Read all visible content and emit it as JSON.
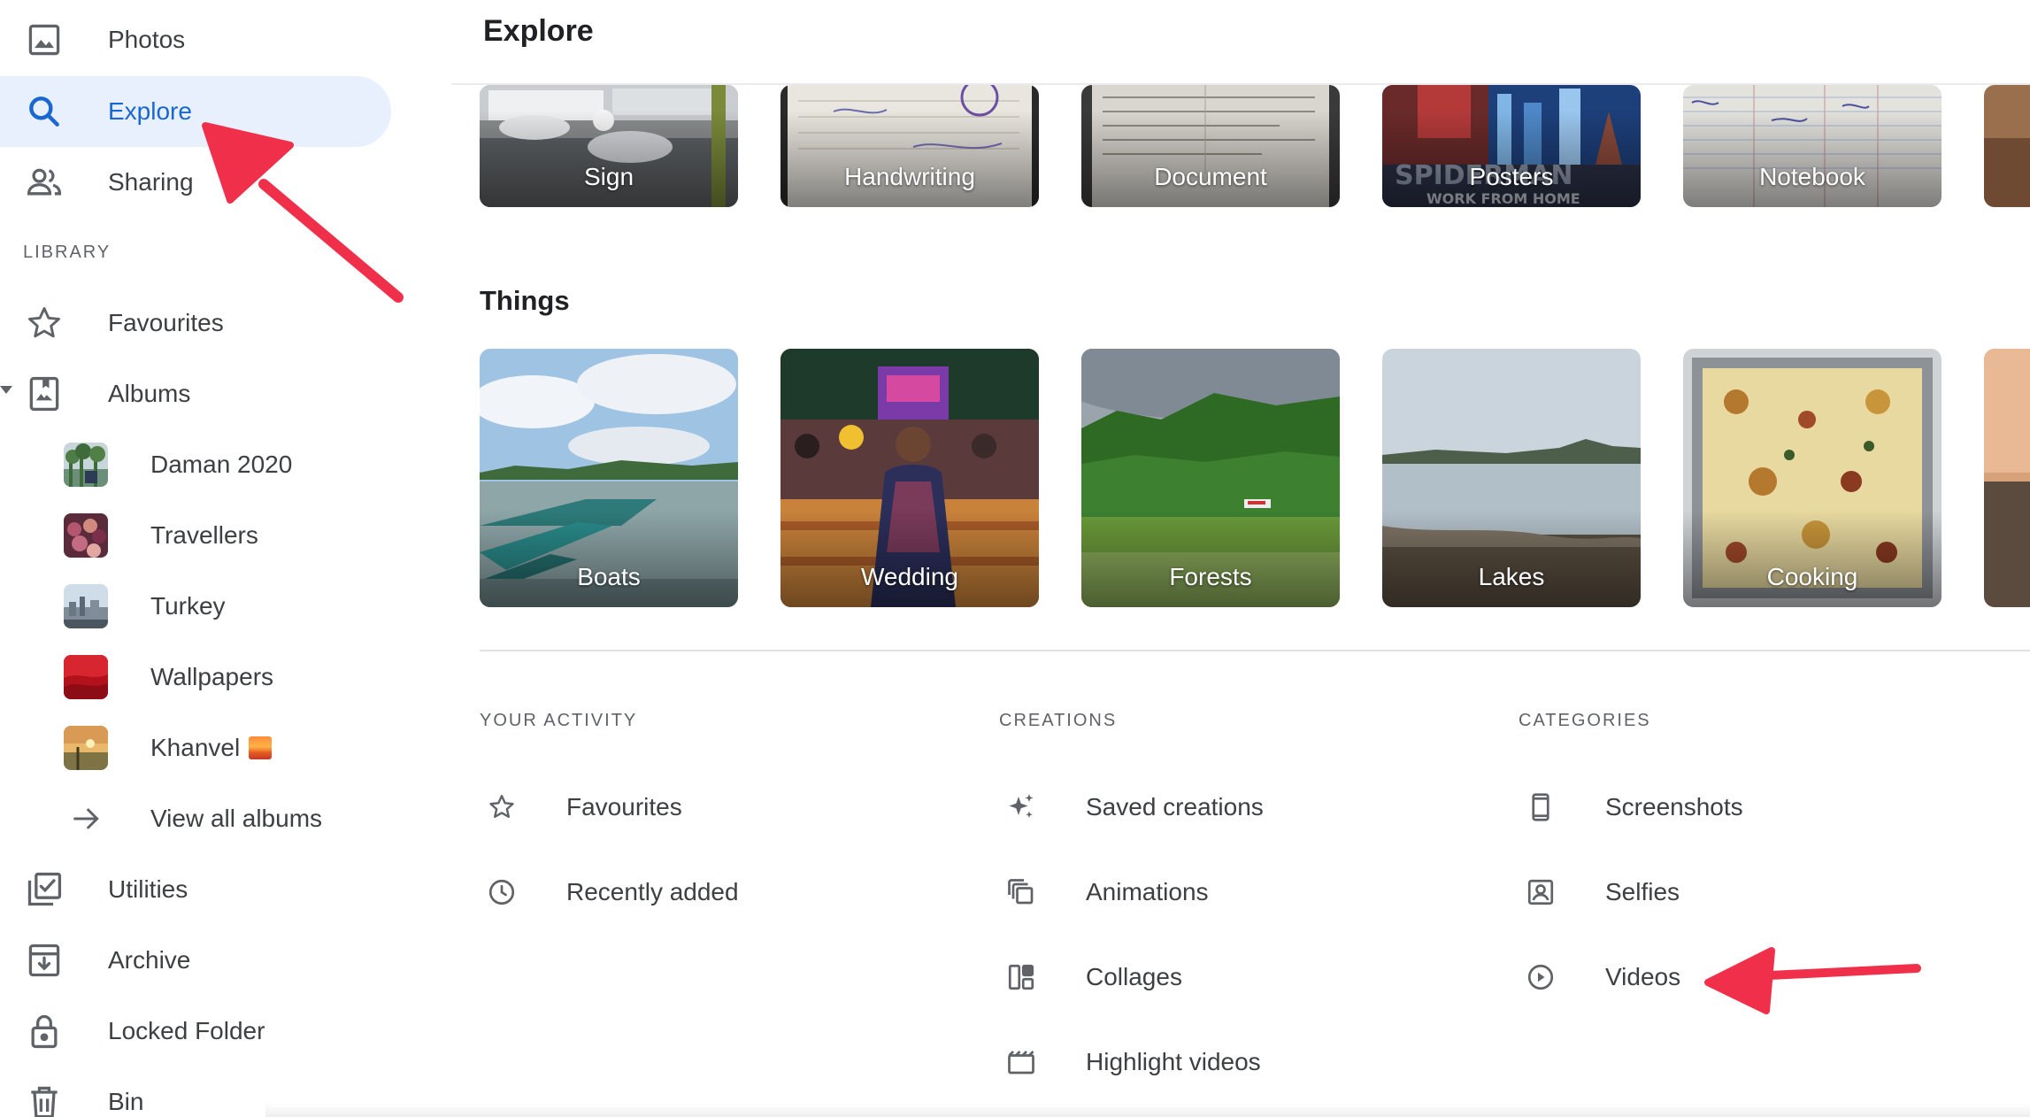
{
  "sidebar": {
    "nav_top": [
      {
        "label": "Photos",
        "icon": "photo-icon",
        "active": false
      },
      {
        "label": "Explore",
        "icon": "search-icon",
        "active": true
      },
      {
        "label": "Sharing",
        "icon": "people-icon",
        "active": false
      }
    ],
    "library_heading": "LIBRARY",
    "favourites_label": "Favourites",
    "albums_label": "Albums",
    "albums": [
      {
        "label": "Daman 2020"
      },
      {
        "label": "Travellers"
      },
      {
        "label": "Turkey"
      },
      {
        "label": "Wallpapers"
      },
      {
        "label": "Khanvel"
      }
    ],
    "view_all_label": "View all albums",
    "nav_bottom": [
      {
        "label": "Utilities",
        "icon": "utilities-icon"
      },
      {
        "label": "Archive",
        "icon": "archive-icon"
      },
      {
        "label": "Locked Folder",
        "icon": "lock-icon"
      },
      {
        "label": "Bin",
        "icon": "trash-icon"
      }
    ]
  },
  "header": {
    "title": "Explore"
  },
  "documents_row": {
    "cards": [
      {
        "label": "Sign"
      },
      {
        "label": "Handwriting"
      },
      {
        "label": "Document"
      },
      {
        "label": "Posters"
      },
      {
        "label": "Notebook"
      }
    ]
  },
  "things_row": {
    "title": "Things",
    "cards": [
      {
        "label": "Boats"
      },
      {
        "label": "Wedding"
      },
      {
        "label": "Forests"
      },
      {
        "label": "Lakes"
      },
      {
        "label": "Cooking"
      }
    ]
  },
  "activity": {
    "heading": "YOUR ACTIVITY",
    "items": [
      {
        "label": "Favourites",
        "icon": "star-icon"
      },
      {
        "label": "Recently added",
        "icon": "clock-icon"
      }
    ]
  },
  "creations": {
    "heading": "CREATIONS",
    "items": [
      {
        "label": "Saved creations",
        "icon": "sparkle-icon"
      },
      {
        "label": "Animations",
        "icon": "animation-icon"
      },
      {
        "label": "Collages",
        "icon": "collage-icon"
      },
      {
        "label": "Highlight videos",
        "icon": "movie-icon"
      }
    ]
  },
  "categories": {
    "heading": "CATEGORIES",
    "items": [
      {
        "label": "Screenshots",
        "icon": "phone-icon"
      },
      {
        "label": "Selfies",
        "icon": "selfie-icon"
      },
      {
        "label": "Videos",
        "icon": "play-circle-icon"
      }
    ]
  },
  "colors": {
    "accent": "#1967d2",
    "active_bg": "#e8f0fe",
    "annotation_arrow": "#f0304a"
  }
}
